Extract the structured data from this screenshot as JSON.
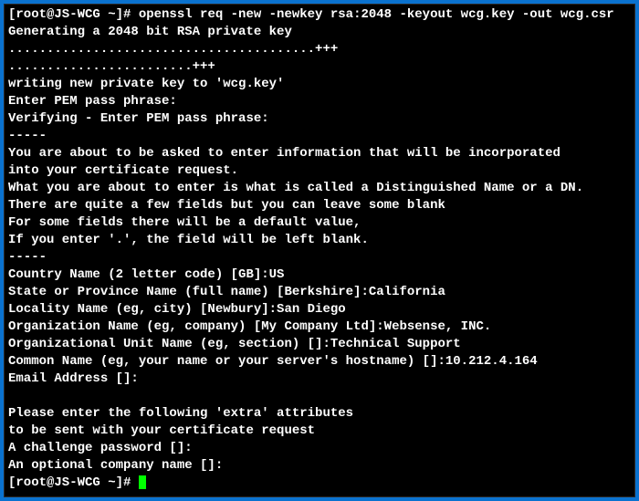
{
  "terminal": {
    "prompt1": "[root@JS-WCG ~]# ",
    "command": "openssl req -new -newkey rsa:2048 -keyout wcg.key -out wcg.csr",
    "prompt2": "[root@JS-WCG ~]# ",
    "lines": [
      "Generating a 2048 bit RSA private key",
      "........................................+++",
      "........................+++",
      "writing new private key to 'wcg.key'",
      "Enter PEM pass phrase:",
      "Verifying - Enter PEM pass phrase:",
      "-----",
      "You are about to be asked to enter information that will be incorporated",
      "into your certificate request.",
      "What you are about to enter is what is called a Distinguished Name or a DN.",
      "There are quite a few fields but you can leave some blank",
      "For some fields there will be a default value,",
      "If you enter '.', the field will be left blank.",
      "-----",
      "Country Name (2 letter code) [GB]:US",
      "State or Province Name (full name) [Berkshire]:California",
      "Locality Name (eg, city) [Newbury]:San Diego",
      "Organization Name (eg, company) [My Company Ltd]:Websense, INC.",
      "Organizational Unit Name (eg, section) []:Technical Support",
      "Common Name (eg, your name or your server's hostname) []:10.212.4.164",
      "Email Address []:",
      "",
      "Please enter the following 'extra' attributes",
      "to be sent with your certificate request",
      "A challenge password []:",
      "An optional company name []:"
    ]
  }
}
